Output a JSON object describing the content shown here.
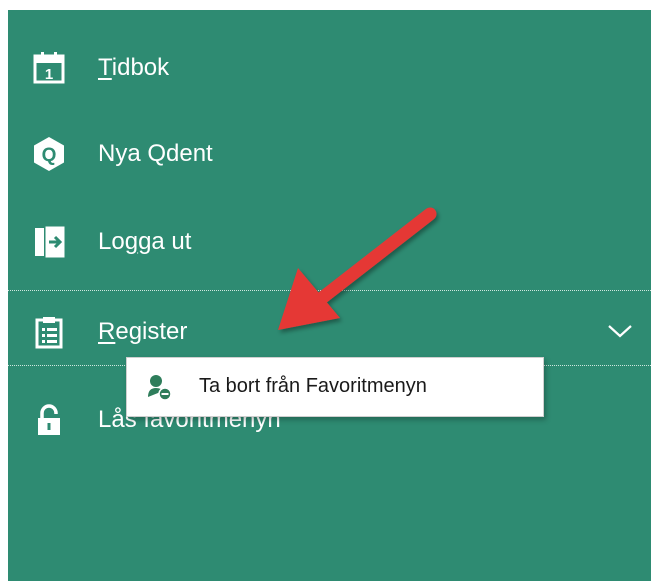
{
  "menu": {
    "items": [
      {
        "label_ul": "T",
        "label_rest": "idbok",
        "icon": "calendar-icon"
      },
      {
        "label_ul": "",
        "label_rest": "Nya Qdent",
        "icon": "qdent-logo-icon"
      },
      {
        "label_pre": "Lo",
        "label_ul": "g",
        "label_rest": "ga ut",
        "icon": "logout-icon"
      },
      {
        "label_ul": "R",
        "label_rest": "egister",
        "icon": "clipboard-icon"
      },
      {
        "label_rest": "Lås favoritmenyn",
        "icon": "lock-icon"
      }
    ]
  },
  "context_menu": {
    "label": "Ta bort från Favoritmenyn",
    "icon": "remove-favorite-icon"
  },
  "colors": {
    "panel": "#2e8b72",
    "text": "#ffffff",
    "arrow": "#e53935"
  }
}
